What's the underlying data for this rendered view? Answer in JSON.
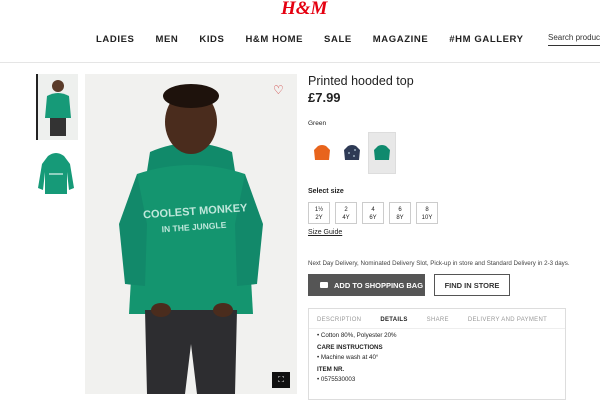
{
  "brand": {
    "logo_text": "H&M",
    "color": "#e50010"
  },
  "nav": [
    "LADIES",
    "MEN",
    "KIDS",
    "H&M HOME",
    "SALE",
    "MAGAZINE",
    "#HM GALLERY"
  ],
  "search": {
    "placeholder": "Search products"
  },
  "product": {
    "title": "Printed hooded top",
    "price": "£7.99",
    "hoodie_text_line1": "COOLEST MONKEY",
    "hoodie_text_line2": "IN THE JUNGLE"
  },
  "color": {
    "label": "Green",
    "swatches": [
      {
        "name": "orange",
        "hex": "#e8641c"
      },
      {
        "name": "navy print",
        "hex": "#2e3a55"
      },
      {
        "name": "green",
        "hex": "#0f8a6e",
        "selected": true
      }
    ]
  },
  "size": {
    "label": "Select size",
    "options": [
      {
        "line1": "1½",
        "line2": "2Y"
      },
      {
        "line1": "2",
        "line2": "4Y"
      },
      {
        "line1": "4",
        "line2": "6Y"
      },
      {
        "line1": "6",
        "line2": "8Y"
      },
      {
        "line1": "8",
        "line2": "10Y"
      }
    ],
    "guide_label": "Size Guide"
  },
  "delivery_text": "Next Day Delivery, Nominated Delivery Slot, Pick-up in store and Standard Delivery in 2-3 days.",
  "buttons": {
    "add_to_bag": "ADD TO SHOPPING BAG",
    "find_in_store": "FIND IN STORE"
  },
  "tabs": [
    "DESCRIPTION",
    "DETAILS",
    "SHARE",
    "DELIVERY AND PAYMENT"
  ],
  "details": {
    "composition": "Cotton 80%, Polyester 20%",
    "care_heading": "CARE INSTRUCTIONS",
    "care_item": "Machine wash at 40°",
    "item_heading": "ITEM NR.",
    "item_number": "0575530003"
  }
}
